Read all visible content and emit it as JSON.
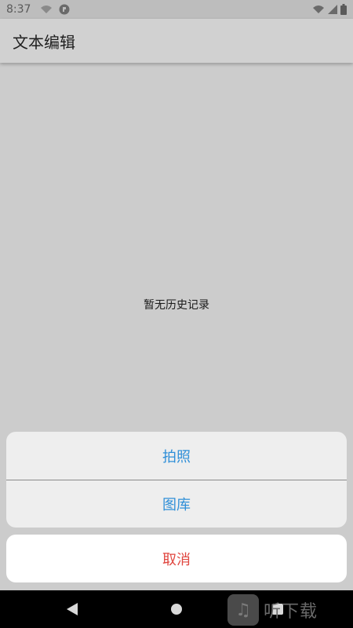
{
  "status_bar": {
    "time": "8:37"
  },
  "toolbar": {
    "title": "文本编辑"
  },
  "content": {
    "empty_message": "暂无历史记录"
  },
  "action_sheet": {
    "options": [
      "拍照",
      "图库"
    ],
    "cancel_label": "取消",
    "option_color": "#2f8fd8",
    "cancel_color": "#e0463f"
  },
  "watermark": {
    "text": "听下载"
  }
}
